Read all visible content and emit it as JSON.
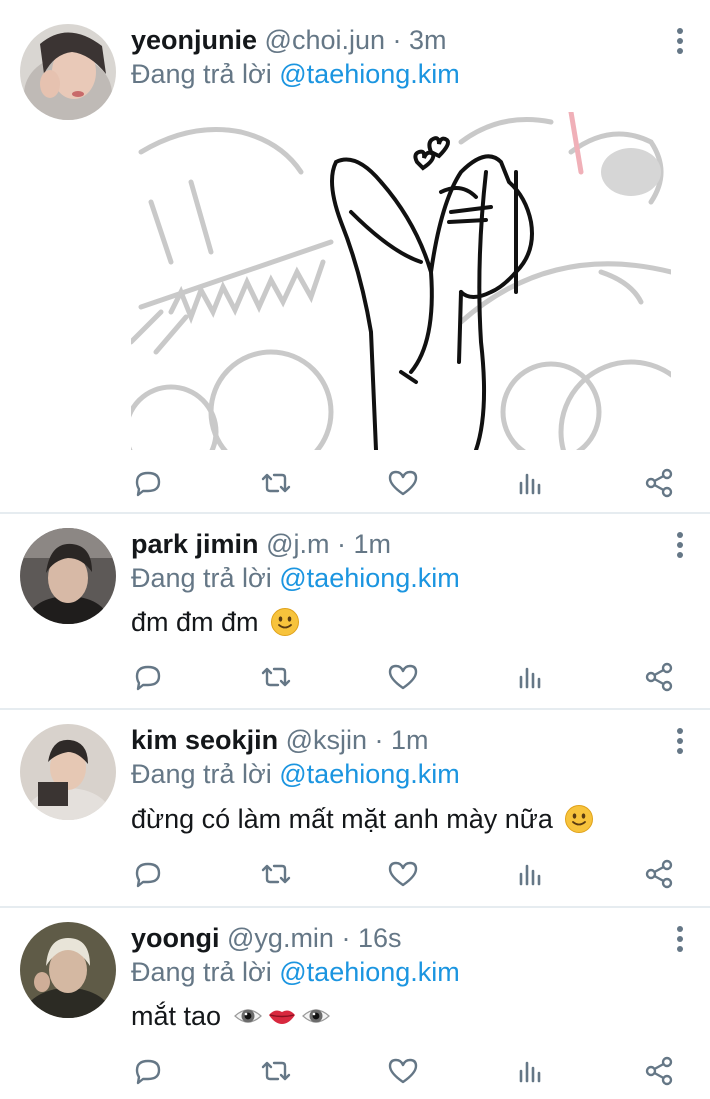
{
  "tweets": [
    {
      "name": "yeonjunie",
      "handle": "@choi.jun",
      "sep": " · ",
      "time": "3m",
      "reply_prefix": "Đang trả lời ",
      "reply_to": "@taehiong.kim",
      "text": "",
      "has_media": true
    },
    {
      "name": "park jimin",
      "handle": "@j.m",
      "sep": " · ",
      "time": "1m",
      "reply_prefix": "Đang trả lời ",
      "reply_to": "@taehiong.kim",
      "text": "đm đm đm",
      "emoji": [
        "slightly-smiling-face"
      ]
    },
    {
      "name": "kim seokjin",
      "handle": "@ksjin",
      "sep": " · ",
      "time": "1m",
      "reply_prefix": "Đang trả lời ",
      "reply_to": "@taehiong.kim",
      "text": "đừng có làm mất mặt anh mày nữa",
      "emoji": [
        "slightly-smiling-face"
      ]
    },
    {
      "name": "yoongi",
      "handle": "@yg.min",
      "sep": " · ",
      "time": "16s",
      "reply_prefix": "Đang trả lời ",
      "reply_to": "@taehiong.kim",
      "text": "mắt tao",
      "emoji": [
        "eye",
        "mouth",
        "eye"
      ]
    }
  ],
  "actions": [
    "reply-icon",
    "retweet-icon",
    "like-icon",
    "analytics-icon",
    "share-icon"
  ],
  "colors": {
    "accent": "#1b95e0",
    "muted": "#657786",
    "icon": "#657786",
    "divider": "#e6ecf0"
  }
}
